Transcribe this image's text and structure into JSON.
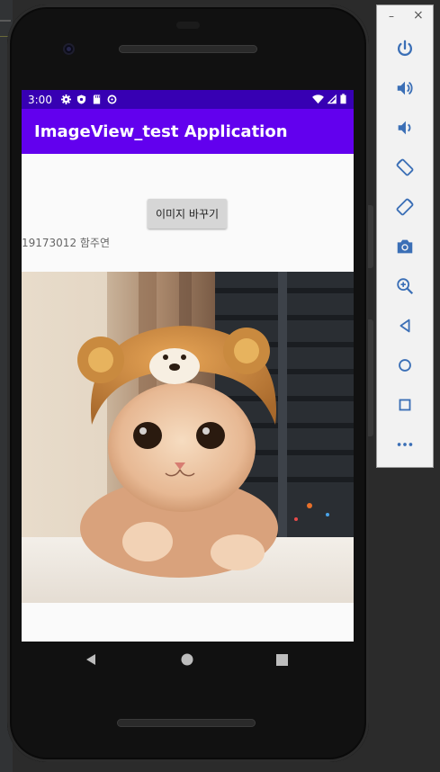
{
  "status_bar": {
    "time": "3:00"
  },
  "app": {
    "title": "ImageView_test Application",
    "change_image_button": "이미지 바꾸기",
    "student_caption": "19173012 함주연"
  },
  "image": {
    "description_icon": "cat-wearing-bear-hat-photo"
  },
  "emulator_panel": {
    "minimize": "–",
    "close": "×",
    "buttons": [
      "power",
      "volume-up",
      "volume-down",
      "rotate-left",
      "rotate-right",
      "screenshot",
      "zoom",
      "back",
      "home",
      "overview",
      "more"
    ]
  },
  "colors": {
    "status_bar": "#3700b3",
    "app_bar": "#6200ee",
    "panel_icon": "#3b6fb6"
  }
}
